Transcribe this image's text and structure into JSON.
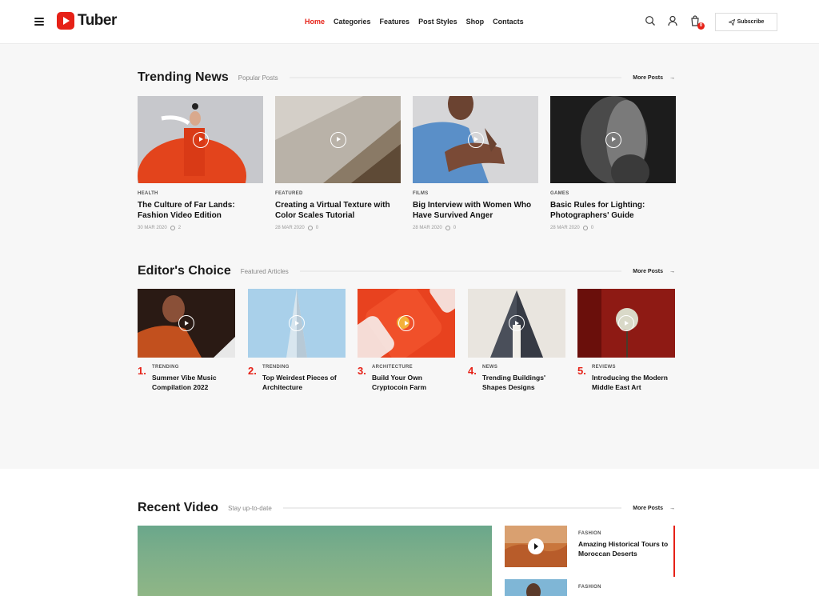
{
  "header": {
    "logo_text": "Tuber",
    "nav": [
      {
        "label": "Home",
        "active": true
      },
      {
        "label": "Categories",
        "active": false
      },
      {
        "label": "Features",
        "active": false
      },
      {
        "label": "Post Styles",
        "active": false
      },
      {
        "label": "Shop",
        "active": false
      },
      {
        "label": "Contacts",
        "active": false
      }
    ],
    "cart_count": "0",
    "subscribe_label": "Subscribe",
    "icons": [
      "menu-icon",
      "search-icon",
      "user-icon",
      "cart-icon",
      "send-icon"
    ]
  },
  "trending": {
    "title": "Trending News",
    "subtitle": "Popular Posts",
    "more": "More Posts",
    "arrow": "→",
    "posts": [
      {
        "category": "HEALTH",
        "title": "The Culture of Far Lands: Fashion Video Edition",
        "date": "30 MAR 2020",
        "comments": "2"
      },
      {
        "category": "FEATURED",
        "title": "Creating a Virtual Texture with Color Scales Tutorial",
        "date": "28 MAR 2020",
        "comments": "0"
      },
      {
        "category": "FILMS",
        "title": "Big Interview with Women Who Have Survived Anger",
        "date": "28 MAR 2020",
        "comments": "0"
      },
      {
        "category": "GAMES",
        "title": "Basic Rules for Lighting: Photographers' Guide",
        "date": "28 MAR 2020",
        "comments": "0"
      }
    ]
  },
  "editors": {
    "title": "Editor's Choice",
    "subtitle": "Featured Articles",
    "more": "More Posts",
    "arrow": "→",
    "posts": [
      {
        "num": "1.",
        "category": "TRENDING",
        "title": "Summer Vibe Music Compilation 2022"
      },
      {
        "num": "2.",
        "category": "TRENDING",
        "title": "Top Weirdest Pieces of Architecture"
      },
      {
        "num": "3.",
        "category": "ARCHITECTURE",
        "title": "Build Your Own Cryptocoin Farm"
      },
      {
        "num": "4.",
        "category": "NEWS",
        "title": "Trending Buildings' Shapes Designs"
      },
      {
        "num": "5.",
        "category": "REVIEWS",
        "title": "Introducing the Modern Middle East Art"
      }
    ]
  },
  "recent": {
    "title": "Recent Video",
    "subtitle": "Stay up-to-date",
    "more": "More Posts",
    "arrow": "→",
    "side": [
      {
        "category": "FASHION",
        "title": "Amazing Historical Tours to Moroccan Deserts"
      },
      {
        "category": "FASHION",
        "title": ""
      }
    ]
  },
  "colors": {
    "accent": "#e62117",
    "background": "#f7f7f7"
  }
}
